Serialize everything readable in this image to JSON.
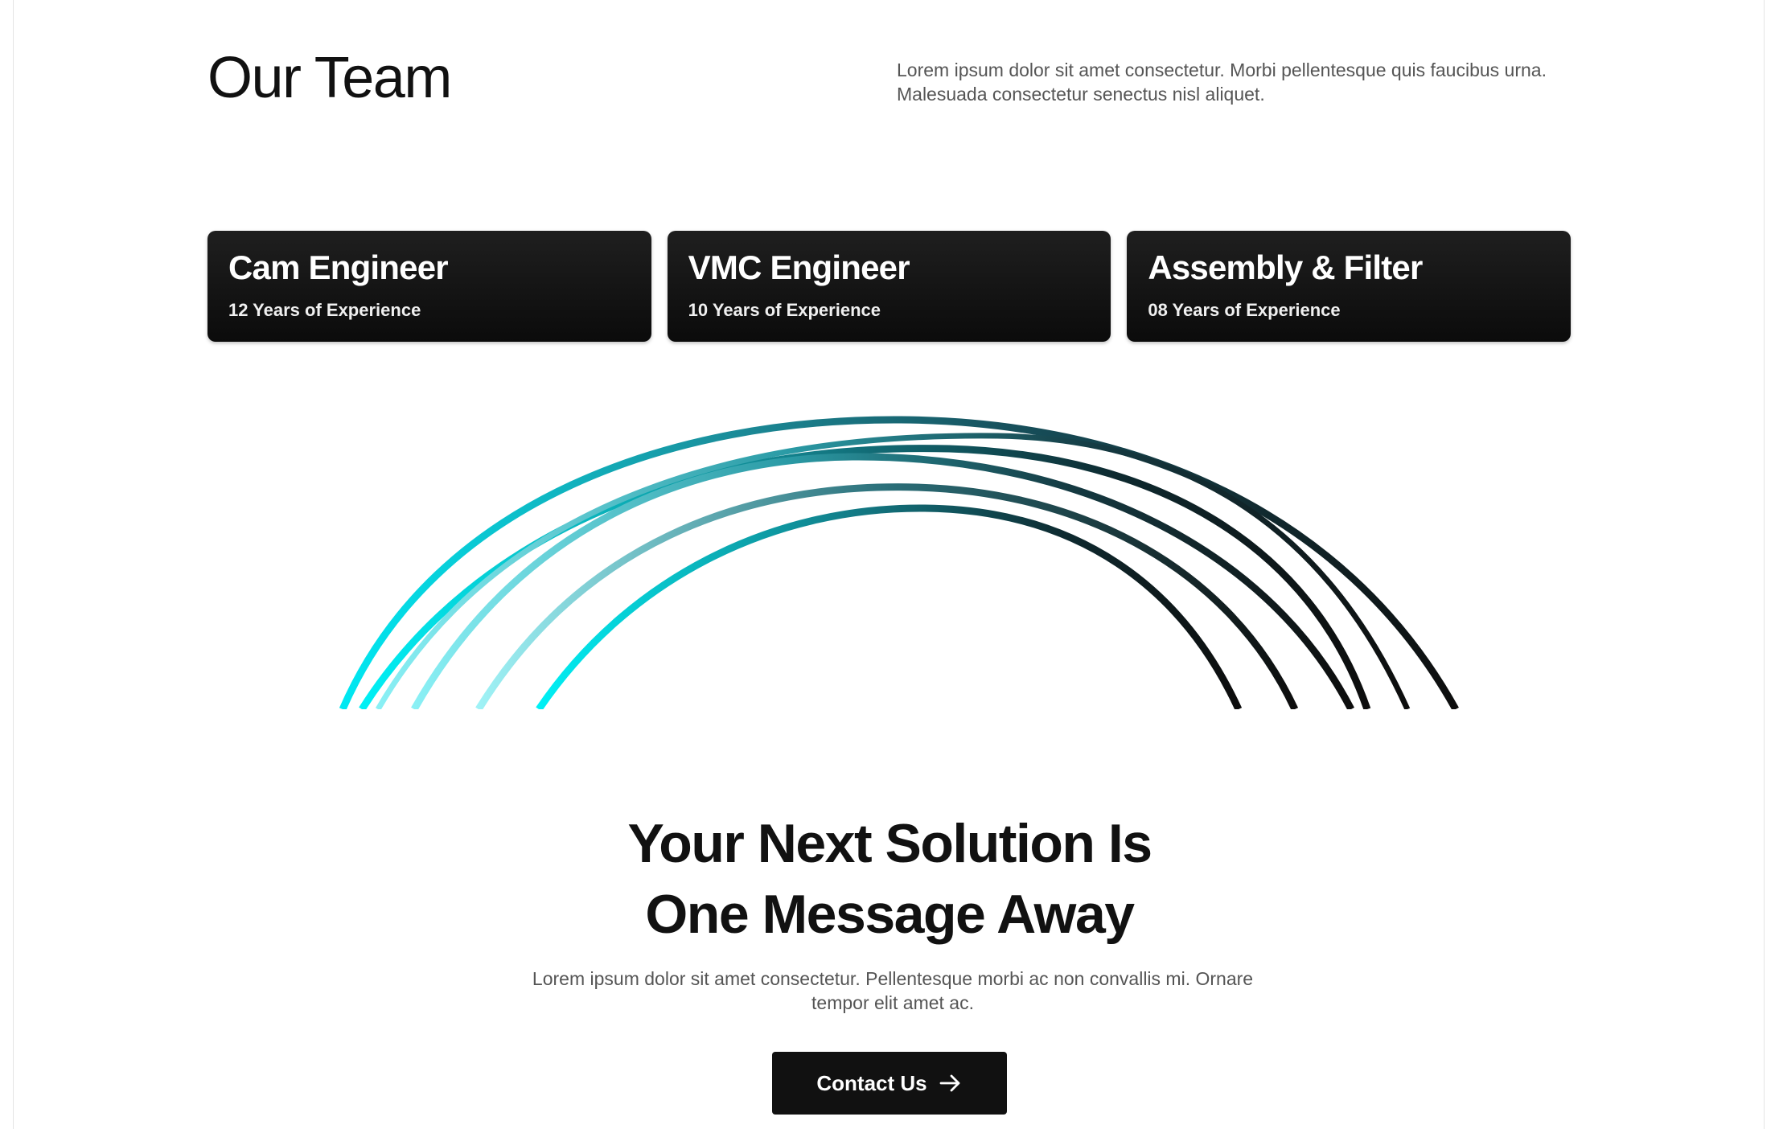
{
  "team": {
    "title": "Our Team",
    "description": "Lorem ipsum dolor sit amet consectetur. Morbi pellentesque quis faucibus urna. Malesuada consectetur senectus nisl aliquet.",
    "cards": [
      {
        "title": "Cam Engineer",
        "experience": "12 Years of Experience"
      },
      {
        "title": "VMC Engineer",
        "experience": "10 Years of Experience"
      },
      {
        "title": "Assembly & Filter",
        "experience": "08 Years of Experience"
      }
    ]
  },
  "decoration": {
    "icon": "arcs-graphic",
    "gradient_colors": [
      "#00e5f0",
      "#7fe8f0",
      "#1a8a94",
      "#0f3f4a",
      "#111111"
    ]
  },
  "cta": {
    "title_line1": "Your Next Solution Is",
    "title_line2": "One Message Away",
    "description": "Lorem ipsum dolor sit amet consectetur. Pellentesque morbi ac non convallis mi. Ornare tempor elit amet ac.",
    "button_label": "Contact Us",
    "button_icon": "arrow-right-icon"
  }
}
